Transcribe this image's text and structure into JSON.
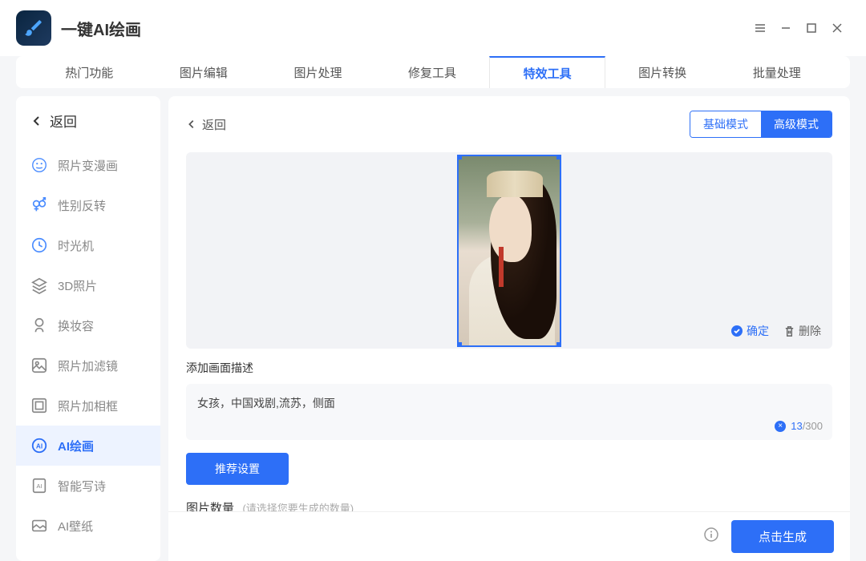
{
  "app": {
    "title": "一键AI绘画"
  },
  "tabs": [
    "热门功能",
    "图片编辑",
    "图片处理",
    "修复工具",
    "特效工具",
    "图片转换",
    "批量处理"
  ],
  "active_tab": 4,
  "sidebar": {
    "back": "返回",
    "items": [
      {
        "label": "照片变漫画"
      },
      {
        "label": "性别反转"
      },
      {
        "label": "时光机"
      },
      {
        "label": "3D照片"
      },
      {
        "label": "换妆容"
      },
      {
        "label": "照片加滤镜"
      },
      {
        "label": "照片加相框"
      },
      {
        "label": "AI绘画"
      },
      {
        "label": "智能写诗"
      },
      {
        "label": "AI壁纸"
      }
    ],
    "active": 7
  },
  "content": {
    "back": "返回",
    "mode_basic": "基础模式",
    "mode_adv": "高级模式",
    "confirm": "确定",
    "delete": "删除",
    "desc_label": "添加画面描述",
    "desc_value": "女孩，中国戏剧,流苏，侧面",
    "desc_count": "13",
    "desc_max": "/300",
    "rec_btn": "推荐设置",
    "qty_label": "图片数量",
    "qty_hint": "(请选择您要生成的数量)",
    "generate": "点击生成"
  }
}
